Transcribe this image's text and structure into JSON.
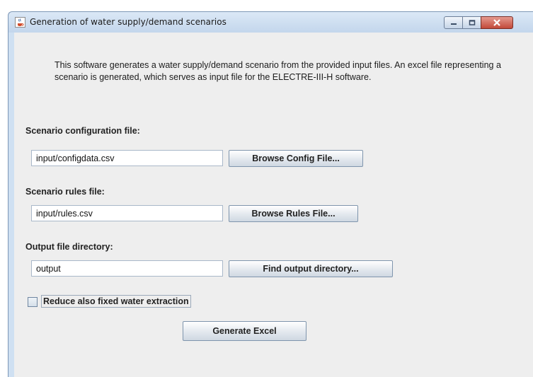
{
  "window": {
    "title": "Generation of water supply/demand scenarios",
    "icon": "java-coffee-cup-icon",
    "controls": [
      "minimize-icon",
      "maximize-icon",
      "close-icon"
    ]
  },
  "description": "This software generates a water supply/demand scenario from the provided input files. An excel file representing a scenario is generated, which serves as input file for the ELECTRE-III-H software.",
  "config": {
    "label": "Scenario configuration file:",
    "value": "input/configdata.csv",
    "button": "Browse Config File..."
  },
  "rules": {
    "label": "Scenario rules file:",
    "value": "input/rules.csv",
    "button": "Browse Rules File..."
  },
  "output": {
    "label": "Output file directory:",
    "value": "output",
    "button": "Find output directory..."
  },
  "options": {
    "reduce_fixed_label": "Reduce also fixed water extraction",
    "reduce_fixed_checked": false
  },
  "actions": {
    "generate_label": "Generate Excel"
  },
  "colors": {
    "titlebar": "#cfe0f2",
    "content_bg": "#eeeeee",
    "close_button": "#c24a3a"
  }
}
